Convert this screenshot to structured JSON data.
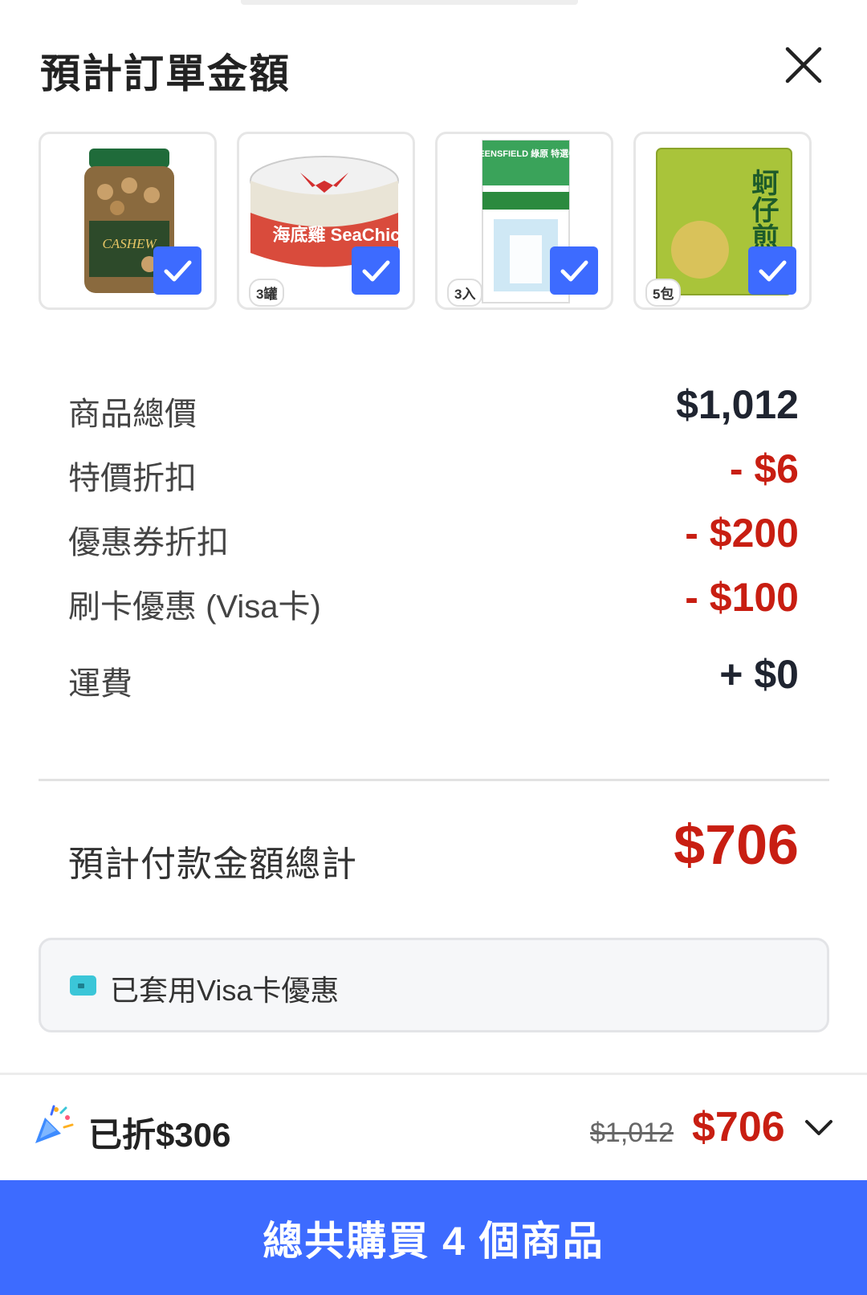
{
  "header": {
    "title": "預計訂單金額"
  },
  "products": [
    {
      "qty": "",
      "name": "CASHEW"
    },
    {
      "qty": "3罐",
      "name": "海底雞 SeaChic"
    },
    {
      "qty": "3入",
      "name": "GREENSFIELD 綠原 特選牛奶"
    },
    {
      "qty": "5包",
      "name": "蚵仔煎"
    }
  ],
  "summary": {
    "items": [
      {
        "label": "商品總價",
        "value": "$1,012",
        "style": "normal"
      },
      {
        "label": "特價折扣",
        "value": "- $6",
        "style": "red"
      },
      {
        "label": "優惠券折扣",
        "value": "- $200",
        "style": "red"
      },
      {
        "label": "刷卡優惠 (Visa卡)",
        "value": "- $100",
        "style": "red"
      },
      {
        "label": "運費",
        "value": "+ $0",
        "style": "normal"
      }
    ],
    "total_label": "預計付款金額總計",
    "total_value": "$706"
  },
  "notice": {
    "text": "已套用Visa卡優惠"
  },
  "footer": {
    "saved_text": "已折$306",
    "original_price": "$1,012",
    "final_price": "$706",
    "buy_button": "總共購買 4 個商品"
  },
  "colors": {
    "accent": "#3d6bff",
    "price_red": "#c81e12",
    "card_icon": "#3bc6d8"
  }
}
